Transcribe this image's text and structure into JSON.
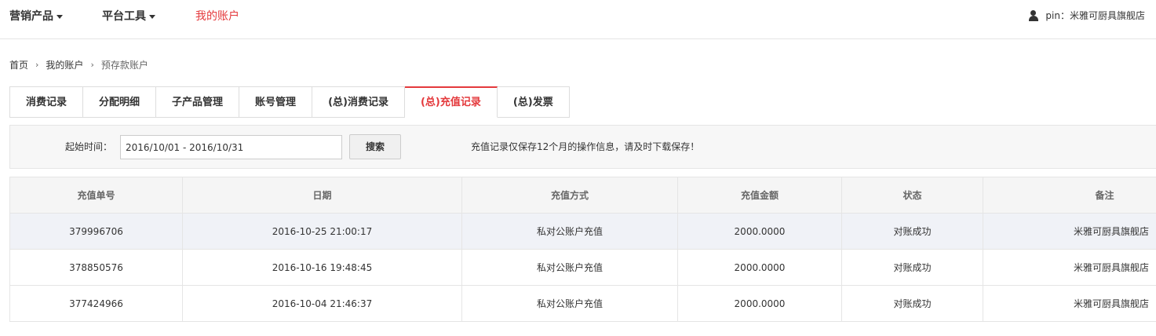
{
  "topnav": {
    "items": [
      {
        "label": "营销产品"
      },
      {
        "label": "平台工具"
      },
      {
        "label": "我的账户"
      }
    ],
    "user": {
      "prefix": "pin：",
      "name": "米雅可厨具旗舰店"
    }
  },
  "breadcrumb": {
    "items": [
      "首页",
      "我的账户",
      "预存款账户"
    ]
  },
  "tabs": [
    "消费记录",
    "分配明细",
    "子产品管理",
    "账号管理",
    "(总)消费记录",
    "(总)充值记录",
    "(总)发票"
  ],
  "search": {
    "label": "起始时间：",
    "date_range": "2016/10/01 - 2016/10/31",
    "button_label": "搜索",
    "notice": "充值记录仅保存12个月的操作信息，请及时下载保存！"
  },
  "table": {
    "headers": [
      "充值单号",
      "日期",
      "充值方式",
      "充值金额",
      "状态",
      "备注"
    ],
    "rows": [
      [
        "379996706",
        "2016-10-25 21:00:17",
        "私对公账户充值",
        "2000.0000",
        "对账成功",
        "米雅可厨具旗舰店"
      ],
      [
        "378850576",
        "2016-10-16 19:48:45",
        "私对公账户充值",
        "2000.0000",
        "对账成功",
        "米雅可厨具旗舰店"
      ],
      [
        "377424966",
        "2016-10-04 21:46:37",
        "私对公账户充值",
        "2000.0000",
        "对账成功",
        "米雅可厨具旗舰店"
      ]
    ]
  },
  "colors": {
    "accent": "#e4393c",
    "row_highlight": "#f0f2f7"
  }
}
